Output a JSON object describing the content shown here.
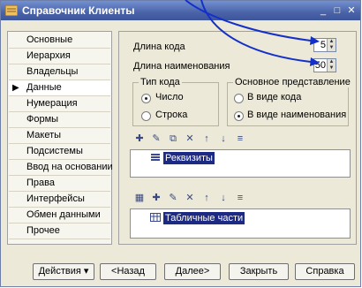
{
  "window": {
    "title": "Справочник Клиенты"
  },
  "nav": {
    "items": [
      {
        "label": "Основные"
      },
      {
        "label": "Иерархия"
      },
      {
        "label": "Владельцы"
      },
      {
        "label": "Данные",
        "active": true
      },
      {
        "label": "Нумерация"
      },
      {
        "label": "Формы"
      },
      {
        "label": "Макеты"
      },
      {
        "label": "Подсистемы"
      },
      {
        "label": "Ввод на основании"
      },
      {
        "label": "Права"
      },
      {
        "label": "Интерфейсы"
      },
      {
        "label": "Обмен данными"
      },
      {
        "label": "Прочее"
      }
    ]
  },
  "data_tab": {
    "code_length": {
      "label": "Длина кода",
      "value": "5"
    },
    "name_length": {
      "label": "Длина наименования",
      "value": "50"
    },
    "code_type": {
      "title": "Тип кода",
      "options": [
        "Число",
        "Строка"
      ],
      "selected": "Число"
    },
    "main_view": {
      "title": "Основное представление",
      "options": [
        "В виде кода",
        "В виде наименования"
      ],
      "selected": "В виде наименования"
    },
    "attributes_list": {
      "item": "Реквизиты"
    },
    "tabular_list": {
      "item": "Табличные части"
    }
  },
  "buttons": {
    "actions": "Действия",
    "back": "<Назад",
    "next": "Далее>",
    "close": "Закрыть",
    "help": "Справка"
  },
  "colors": {
    "titlebar": "#4a63a8",
    "selection": "#1c2a83",
    "annotation_arrow": "#1530c8"
  }
}
